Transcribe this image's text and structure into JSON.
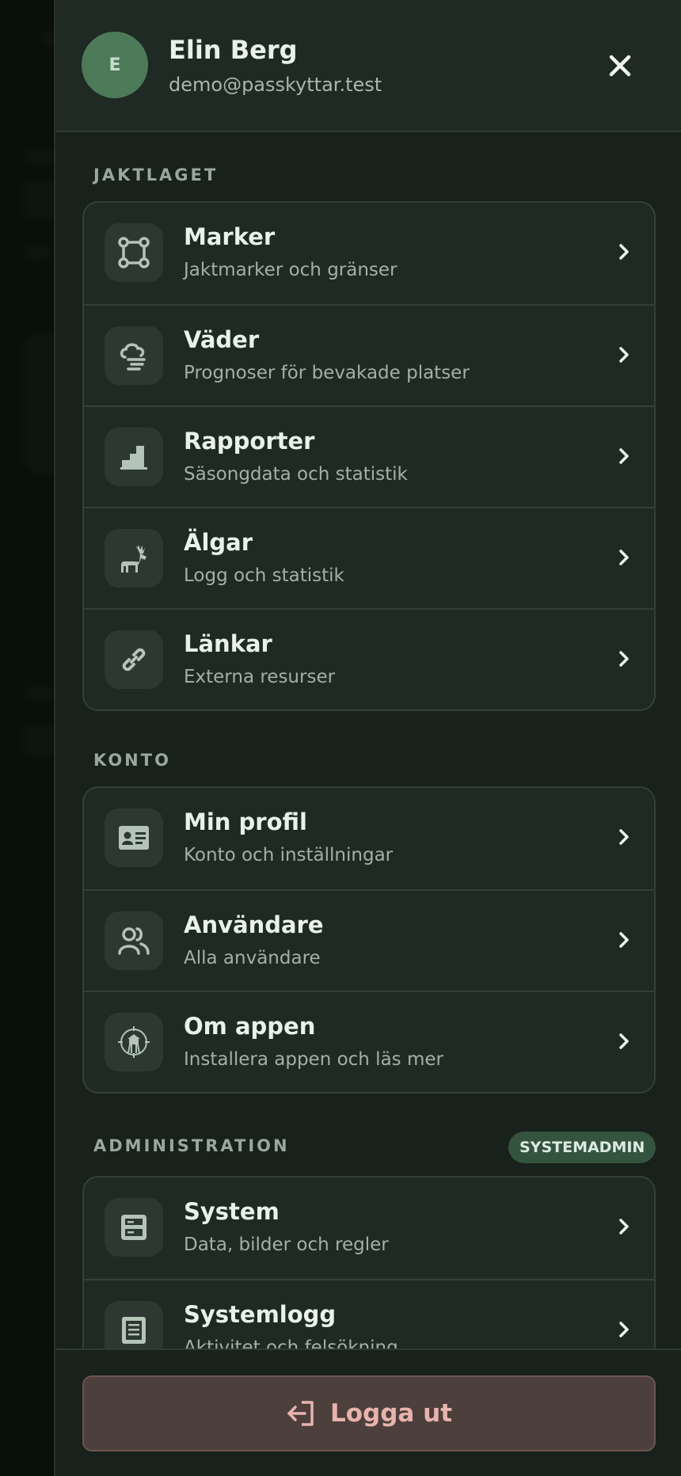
{
  "user": {
    "initial": "E",
    "name": "Elin Berg",
    "email": "demo@passkyttar.test"
  },
  "sections": {
    "jaktlaget": {
      "label": "JAKTLAGET",
      "items": [
        {
          "title": "Marker",
          "subtitle": "Jaktmarker och gränser",
          "icon": "polygon-icon"
        },
        {
          "title": "Väder",
          "subtitle": "Prognoser för bevakade platser",
          "icon": "weather-icon"
        },
        {
          "title": "Rapporter",
          "subtitle": "Säsongdata och statistik",
          "icon": "stairs-chart-icon"
        },
        {
          "title": "Älgar",
          "subtitle": "Logg och statistik",
          "icon": "moose-icon"
        },
        {
          "title": "Länkar",
          "subtitle": "Externa resurser",
          "icon": "link-icon"
        }
      ]
    },
    "konto": {
      "label": "KONTO",
      "items": [
        {
          "title": "Min profil",
          "subtitle": "Konto och inställningar",
          "icon": "id-card-icon"
        },
        {
          "title": "Användare",
          "subtitle": "Alla användare",
          "icon": "users-icon"
        },
        {
          "title": "Om appen",
          "subtitle": "Installera appen och läs mer",
          "icon": "hunting-tower-icon"
        }
      ]
    },
    "administration": {
      "label": "ADMINISTRATION",
      "badge": "SYSTEMADMIN",
      "items": [
        {
          "title": "System",
          "subtitle": "Data, bilder och regler",
          "icon": "server-icon"
        },
        {
          "title": "Systemlogg",
          "subtitle": "Aktivitet och felsökning",
          "icon": "log-icon"
        }
      ]
    }
  },
  "logout": {
    "label": "Logga ut",
    "icon": "logout-icon"
  },
  "colors": {
    "drawer_bg": "#18211c",
    "card_bg": "#1f2a24",
    "avatar_bg": "#4d7a58",
    "badge_bg": "#355440",
    "logout_bg": "#4c3f3c",
    "logout_text": "#e8b3ae"
  }
}
